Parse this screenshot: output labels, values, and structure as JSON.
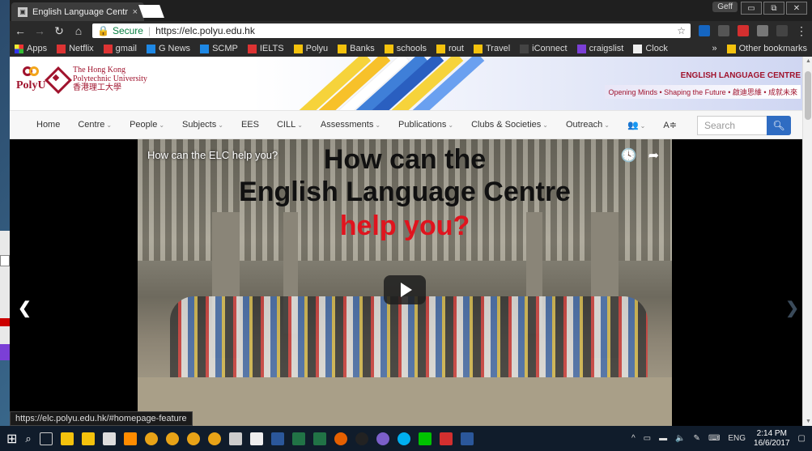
{
  "browser": {
    "tab_title": "English Language Centre",
    "tab_close": "×",
    "user_badge": "Geff",
    "window_controls": [
      "▭",
      "⧉",
      "✕"
    ],
    "secure_label": "Secure",
    "url": "https://elc.polyu.edu.hk",
    "status_url": "https://elc.polyu.edu.hk/#homepage-feature"
  },
  "bookmarks": {
    "items": [
      "Apps",
      "Netflix",
      "gmail",
      "G News",
      "SCMP",
      "IELTS",
      "Polyu",
      "Banks",
      "schools",
      "rout",
      "Travel",
      "iConnect",
      "craigslist",
      "Clock"
    ],
    "more": "»",
    "other": "Other bookmarks"
  },
  "header": {
    "polyu_text": "PolyU",
    "uni_name_line1": "The Hong Kong",
    "uni_name_line2": "Polytechnic University",
    "uni_name_chinese": "香港理工大學",
    "elc_title": "ENGLISH LANGUAGE CENTRE",
    "elc_tagline": "Opening Minds • Shaping the Future • 啟迪思維 • 成就未來"
  },
  "nav": {
    "items": [
      {
        "label": "Home",
        "caret": false
      },
      {
        "label": "Centre",
        "caret": true
      },
      {
        "label": "People",
        "caret": true
      },
      {
        "label": "Subjects",
        "caret": true
      },
      {
        "label": "EES",
        "caret": false
      },
      {
        "label": "CILL",
        "caret": true
      },
      {
        "label": "Assessments",
        "caret": true
      },
      {
        "label": "Publications",
        "caret": true
      },
      {
        "label": "Clubs & Societies",
        "caret": true
      },
      {
        "label": "Outreach",
        "caret": true
      },
      {
        "label": "👥",
        "caret": true
      },
      {
        "label": "A≑",
        "caret": false
      }
    ],
    "search_placeholder": "Search"
  },
  "video": {
    "title": "How can the ELC help you?",
    "headline_1": "How can the",
    "headline_2": "English Language Centre",
    "headline_3": "help you?",
    "headline_color": "#e0141e"
  },
  "taskbar": {
    "language": "ENG",
    "time": "2:14 PM",
    "date": "16/6/2017"
  },
  "colors": {
    "polyu_red": "#a0132d",
    "search_blue": "#2f6cc2"
  }
}
